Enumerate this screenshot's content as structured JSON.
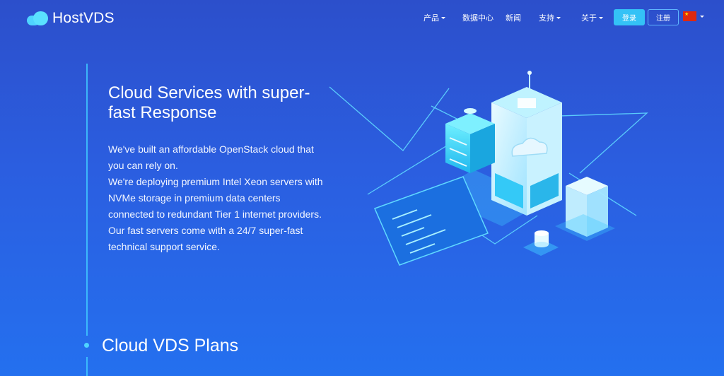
{
  "brand": {
    "name": "HostVDS"
  },
  "nav": {
    "items": [
      {
        "label": "产品",
        "dropdown": true
      },
      {
        "label": "数据中心",
        "dropdown": false
      },
      {
        "label": "新闻",
        "dropdown": false
      },
      {
        "label": "支持",
        "dropdown": true
      },
      {
        "label": "关于",
        "dropdown": true
      }
    ],
    "login_label": "登录",
    "register_label": "注册",
    "language_flag": "cn-flag-icon"
  },
  "hero": {
    "title": "Cloud Services with super-fast Response",
    "description_1": "We've built an affordable OpenStack cloud that you can rely on.",
    "description_2": "We're deploying premium Intel Xeon servers with NVMe storage in premium data centers connected to redundant Tier 1 internet providers. Our fast servers come with a 24/7 super-fast technical support service."
  },
  "plans": {
    "title": "Cloud VDS Plans"
  },
  "colors": {
    "accent": "#34c2f6",
    "background_top": "#2c4fcb",
    "background_bottom": "#2470ef",
    "line": "#3fc8ff"
  }
}
